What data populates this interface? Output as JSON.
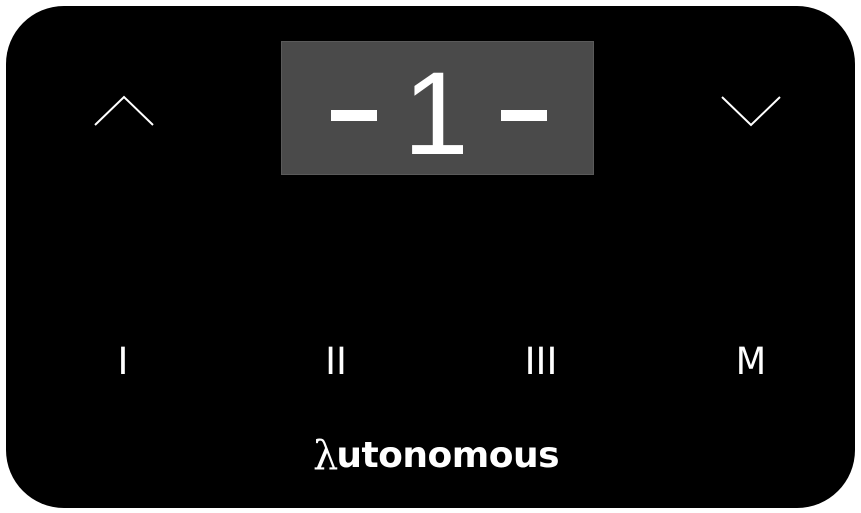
{
  "colors": {
    "panel_background": "#000000",
    "display_background": "#4a4a4a",
    "foreground": "#ffffff"
  },
  "controls": {
    "up_icon": "chevron-up-icon",
    "down_icon": "chevron-down-icon"
  },
  "display": {
    "value": "1",
    "left_indicator": "dash",
    "right_indicator": "dash"
  },
  "presets": {
    "p1": "I",
    "p2": "II",
    "p3": "III",
    "memory": "M"
  },
  "brand": {
    "symbol": "λ",
    "name": "utonomous"
  }
}
